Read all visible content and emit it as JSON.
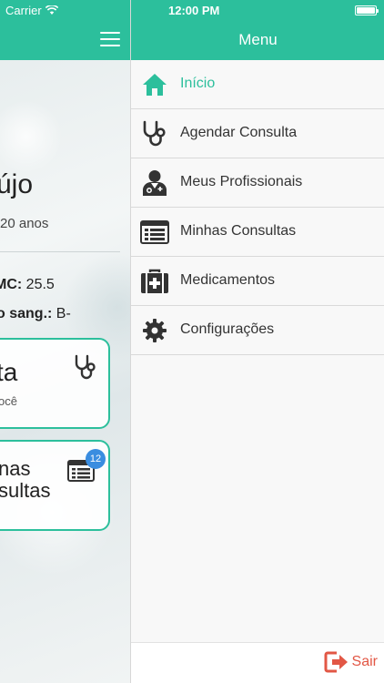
{
  "status_bar": {
    "carrier": "Carrier",
    "time": "12:00 PM"
  },
  "background": {
    "name_partial": "újo",
    "age_partial": "20 anos",
    "imc_label": "MC:",
    "imc_value": "25.5",
    "blood_label": "o sang.:",
    "blood_value": "B-",
    "card1_title": "ta",
    "card1_sub": "ocê",
    "card2_title_line1": "nas",
    "card2_title_line2": "sultas",
    "card2_badge": "12"
  },
  "menu": {
    "title": "Menu",
    "items": [
      {
        "label": "Início",
        "icon": "home-icon",
        "active": true
      },
      {
        "label": "Agendar Consulta",
        "icon": "stethoscope-icon",
        "active": false
      },
      {
        "label": "Meus Profissionais",
        "icon": "doctor-icon",
        "active": false
      },
      {
        "label": "Minhas Consultas",
        "icon": "list-icon",
        "active": false
      },
      {
        "label": "Medicamentos",
        "icon": "medkit-icon",
        "active": false
      },
      {
        "label": "Configurações",
        "icon": "gear-icon",
        "active": false
      }
    ],
    "logout_label": "Sair"
  },
  "colors": {
    "accent": "#2cbf9c",
    "logout": "#e25745",
    "badge": "#3a8de0"
  }
}
